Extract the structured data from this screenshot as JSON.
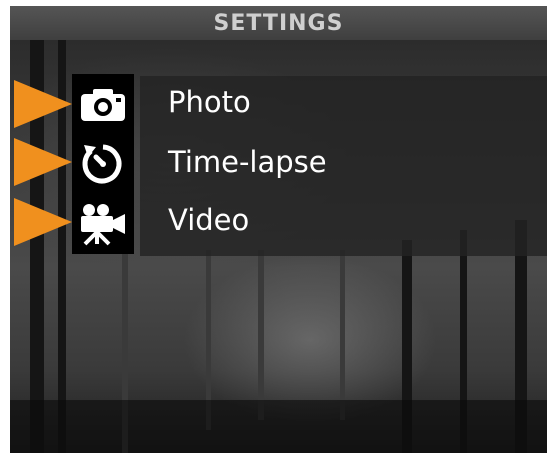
{
  "screen": {
    "title": "SETTINGS"
  },
  "menu": {
    "items": [
      {
        "label": "Photo",
        "icon": "camera-icon"
      },
      {
        "label": "Time-lapse",
        "icon": "time-lapse-icon"
      },
      {
        "label": "Video",
        "icon": "video-camera-icon"
      }
    ]
  },
  "colors": {
    "accent": "#f0901e",
    "title_text": "#cfcfcf",
    "label_text": "#ffffff"
  }
}
